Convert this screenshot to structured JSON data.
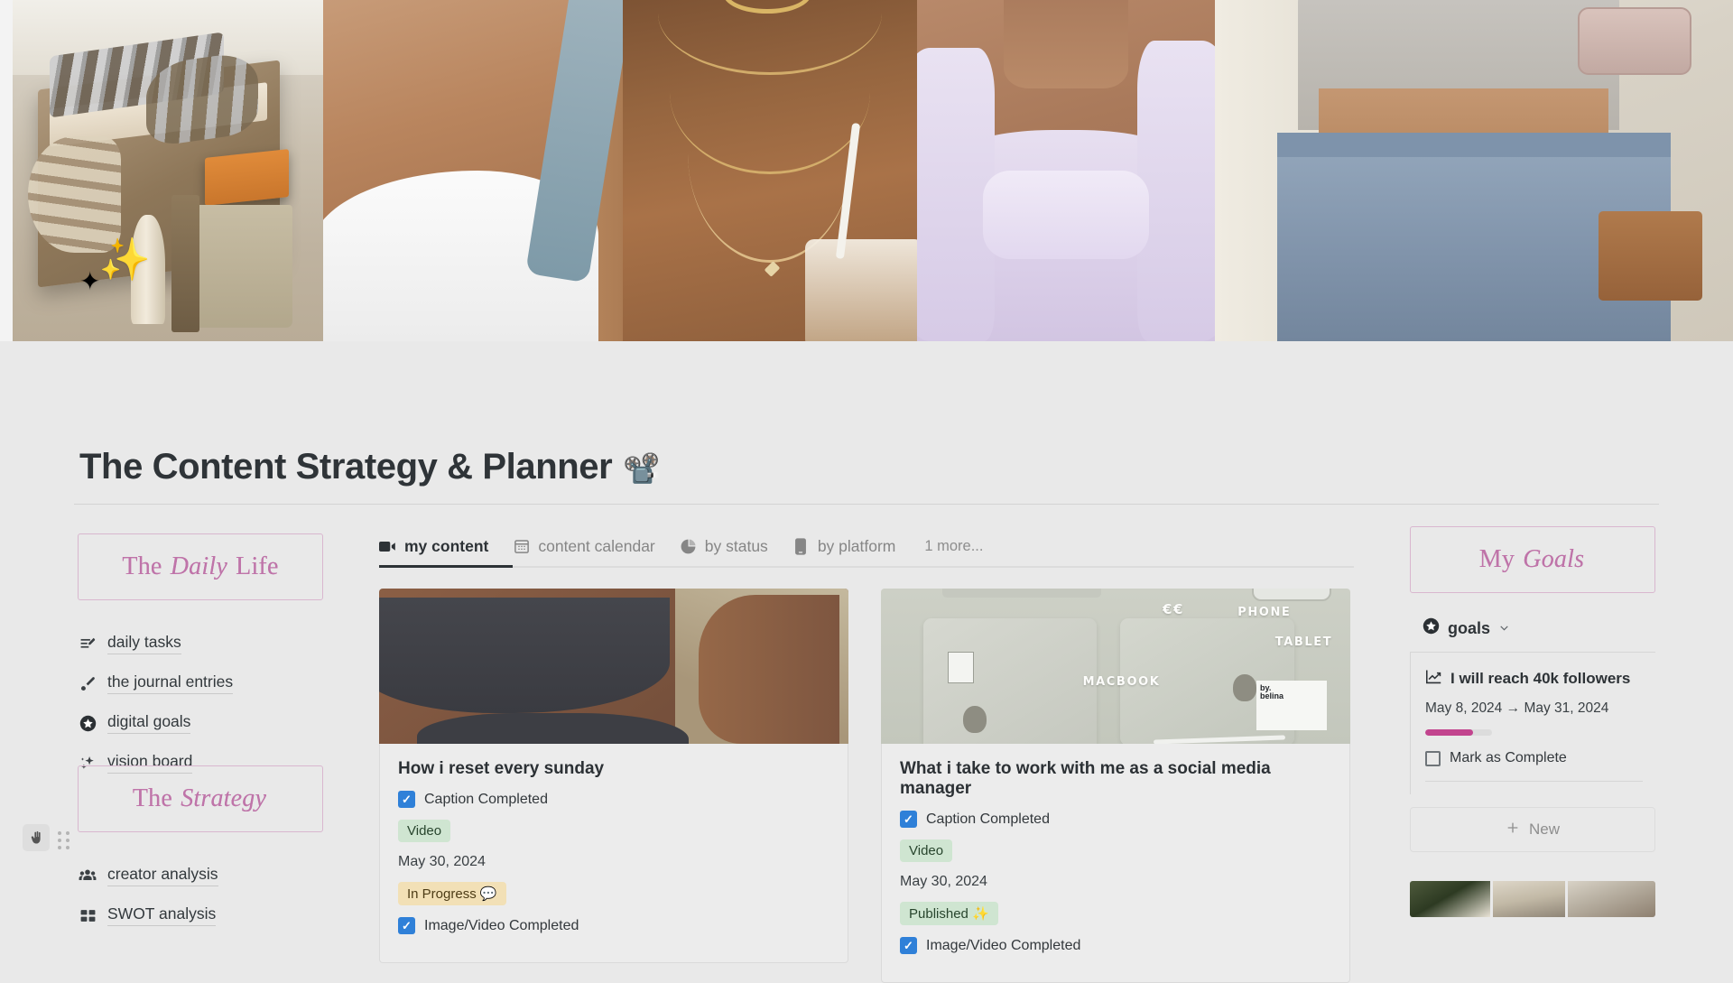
{
  "banner": {
    "images": [
      {
        "name": "home-gym-shelf",
        "alt": "home gym dumbbell shelf with storage basket"
      },
      {
        "name": "white-tank-top",
        "alt": "white tank top with blue strap"
      },
      {
        "name": "gold-necklaces",
        "alt": "layered gold necklaces and iced coffee"
      },
      {
        "name": "lilac-long-sleeve",
        "alt": "lilac long sleeve crop top"
      },
      {
        "name": "mirror-selfie-jeans",
        "alt": "mirror selfie wearing jeans and grey top"
      }
    ],
    "sparkle_large": "✨",
    "sparkle_small": "✦"
  },
  "page": {
    "title": "The Content Strategy & Planner",
    "title_emoji": "📽️",
    "hand_cursor_icon": "✋",
    "drag_handle_icon": "six-dot-drag-handle"
  },
  "sidebar": {
    "sections": [
      {
        "card_label_pre": "The ",
        "card_label_em": "Daily",
        "card_label_post": " Life",
        "items": [
          {
            "label": "daily tasks",
            "icon": "list-edit-icon"
          },
          {
            "label": "the journal entries",
            "icon": "paintbrush-icon"
          },
          {
            "label": "digital goals",
            "icon": "star-circle-icon"
          },
          {
            "label": "vision board",
            "icon": "sparkles-icon"
          }
        ]
      },
      {
        "card_label_pre": "The ",
        "card_label_em": "Strategy",
        "card_label_post": "",
        "items": [
          {
            "label": "creator analysis",
            "icon": "people-group-icon"
          },
          {
            "label": "SWOT analysis",
            "icon": "grid-squares-icon"
          }
        ]
      }
    ]
  },
  "main": {
    "tabs": [
      {
        "label": "my content",
        "icon": "video-camera-icon",
        "active": true
      },
      {
        "label": "content calendar",
        "icon": "calendar-icon",
        "active": false
      },
      {
        "label": "by status",
        "icon": "pie-chart-icon",
        "active": false
      },
      {
        "label": "by platform",
        "icon": "mobile-phone-icon",
        "active": false
      }
    ],
    "more_tabs_label": "1 more...",
    "cards": [
      {
        "title": "How i reset every sunday",
        "thumbnail": "workout-outfit-photo",
        "caption_checkbox": {
          "label": "Caption Completed",
          "checked": true
        },
        "type_pill": {
          "label": "Video",
          "color": "#cfe5d1"
        },
        "date": "May 30, 2024",
        "status_pill": {
          "label": "In Progress",
          "emoji": "💬",
          "color": "#f2e0b6"
        },
        "media_checkbox": {
          "label": "Image/Video Completed",
          "checked": true
        }
      },
      {
        "title": "What i take to work with me as a social media manager",
        "thumbnail": "desk-devices-photo",
        "thumbnail_labels": [
          "€€",
          "PHONE",
          "TABLET",
          "MACBOOK"
        ],
        "caption_checkbox": {
          "label": "Caption Completed",
          "checked": true
        },
        "type_pill": {
          "label": "Video",
          "color": "#cfe5d1"
        },
        "date": "May 30, 2024",
        "status_pill": {
          "label": "Published",
          "emoji": "✨",
          "color": "#cfe5d1"
        },
        "media_checkbox": {
          "label": "Image/Video Completed",
          "checked": true
        }
      }
    ]
  },
  "right_panel": {
    "card_label_pre": "My ",
    "card_label_em": "Goals",
    "select_label": "goals",
    "select_icon": "star-circle-icon",
    "chevron_icon": "chevron-down-icon",
    "goal": {
      "title": "I will reach 40k followers",
      "icon": "line-chart-up-icon",
      "start_date": "May 8, 2024",
      "arrow": "→",
      "end_date": "May 31, 2024",
      "progress_percent": 72,
      "progress_color": "#c2448e",
      "complete_label": "Mark as Complete",
      "complete_checked": false
    },
    "new_button": {
      "label": "New",
      "icon": "plus-icon"
    },
    "gallery": [
      {
        "name": "gallery-thumb-1"
      },
      {
        "name": "gallery-thumb-2"
      },
      {
        "name": "gallery-thumb-3"
      }
    ]
  }
}
